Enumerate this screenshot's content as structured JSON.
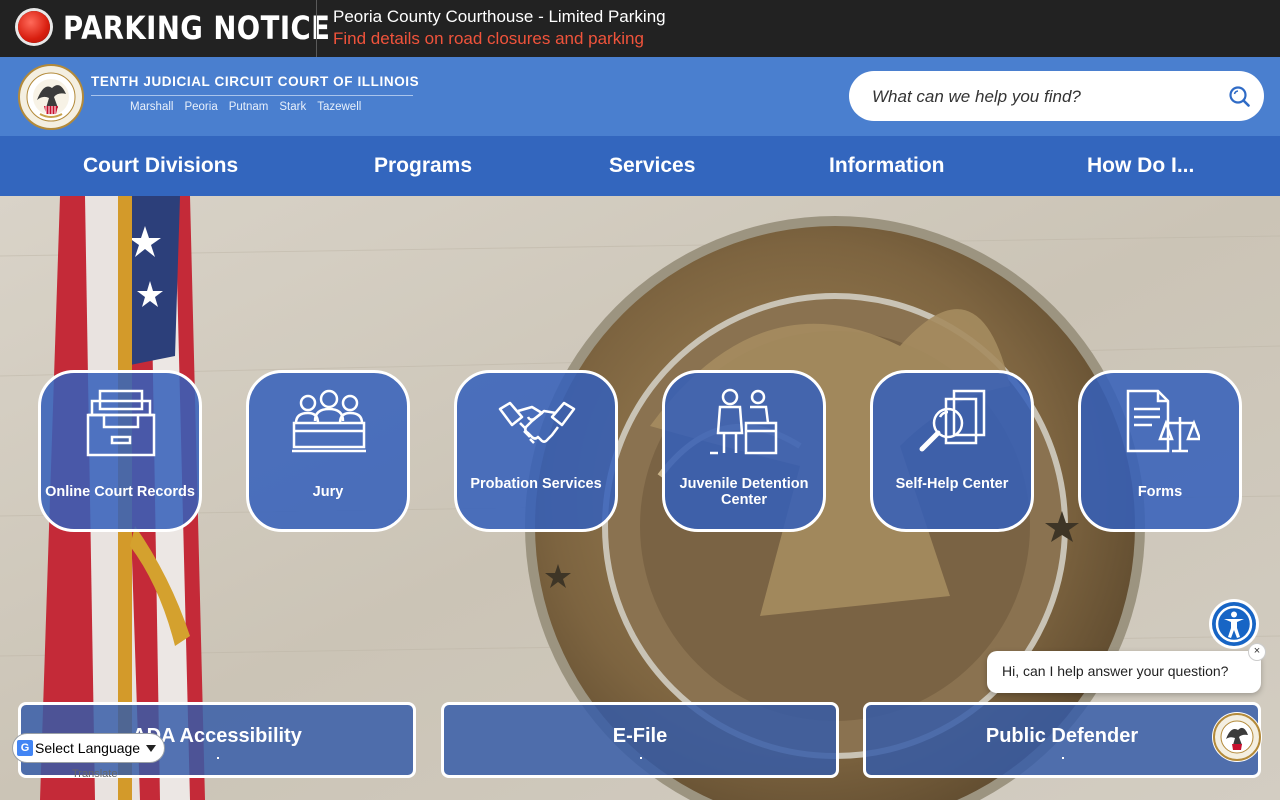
{
  "alert": {
    "label": "PARKING NOTICE",
    "title": "Peoria County Courthouse - Limited Parking",
    "link": "Find details on road closures and parking"
  },
  "header": {
    "court_name": "TENTH JUDICIAL CIRCUIT COURT OF ILLINOIS",
    "counties": [
      "Marshall",
      "Peoria",
      "Putnam",
      "Stark",
      "Tazewell"
    ],
    "search_placeholder": "What can we help you find?"
  },
  "nav": {
    "items": [
      "Court Divisions",
      "Programs",
      "Services",
      "Information",
      "How Do I..."
    ]
  },
  "tiles": [
    {
      "label": "Online Court Records",
      "icon": "file-drawer-icon"
    },
    {
      "label": "Jury",
      "icon": "jury-box-icon"
    },
    {
      "label": "Probation Services",
      "icon": "handshake-icon"
    },
    {
      "label": "Juvenile Detention Center",
      "icon": "people-desk-icon"
    },
    {
      "label": "Self-Help Center",
      "icon": "magnifier-document-icon"
    },
    {
      "label": "Forms",
      "icon": "document-scales-icon"
    }
  ],
  "buttons": [
    "ADA Accessibility",
    "E-File",
    "Public Defender"
  ],
  "translate": {
    "label": "Select Language",
    "powered": "Translate"
  },
  "chat": {
    "message": "Hi, can I help answer your question?",
    "close": "×"
  },
  "colors": {
    "header": "#4a7fcf",
    "nav": "#3366be",
    "alert_bg": "#222222",
    "alert_link": "#f0533b"
  }
}
